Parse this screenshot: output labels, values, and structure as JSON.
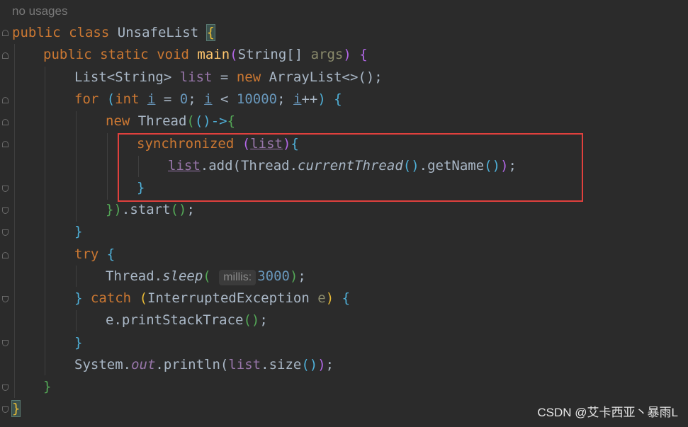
{
  "hint": "no usages",
  "code": {
    "class_decl": [
      "public",
      "class",
      "UnsafeList",
      "{"
    ],
    "main_decl": [
      "public",
      "static",
      "void",
      "main",
      "(",
      "String[] ",
      "args",
      ")",
      "{"
    ],
    "list_decl": [
      "List<String> ",
      "list",
      " = ",
      "new",
      " ArrayList<>();"
    ],
    "for_kw": "for",
    "for_int": "int",
    "loop_var": "i",
    "zero": "0",
    "limit": "10000",
    "new_kw": "new",
    "thread_cls": " Thread",
    "lambda": "()->",
    "sync_kw": "synchronized",
    "list_name": "list",
    "add_call": ".add(",
    "thread_cls2": "Thread.",
    "current_thread": "currentThread",
    "get_name": ".getName",
    "start_call": ".start",
    "try_kw": "try",
    "sleep_cls": "Thread.",
    "sleep_fn": "sleep",
    "inlay_label": "millis:",
    "sleep_value": "3000",
    "catch_kw": "catch",
    "exception": "InterruptedException",
    "exception_var": "e",
    "print_stack": "e.printStackTrace",
    "system": "System.",
    "out": "out",
    "println": ".println(",
    "size_call": ".size"
  },
  "watermark": "CSDN @艾卡西亚丶暴雨L",
  "colors": {
    "background": "#2b2b2b",
    "keyword": "#cc7832",
    "method": "#ffc66d",
    "number": "#6897bb",
    "field": "#9876aa",
    "highlight_box": "#e0403d"
  }
}
